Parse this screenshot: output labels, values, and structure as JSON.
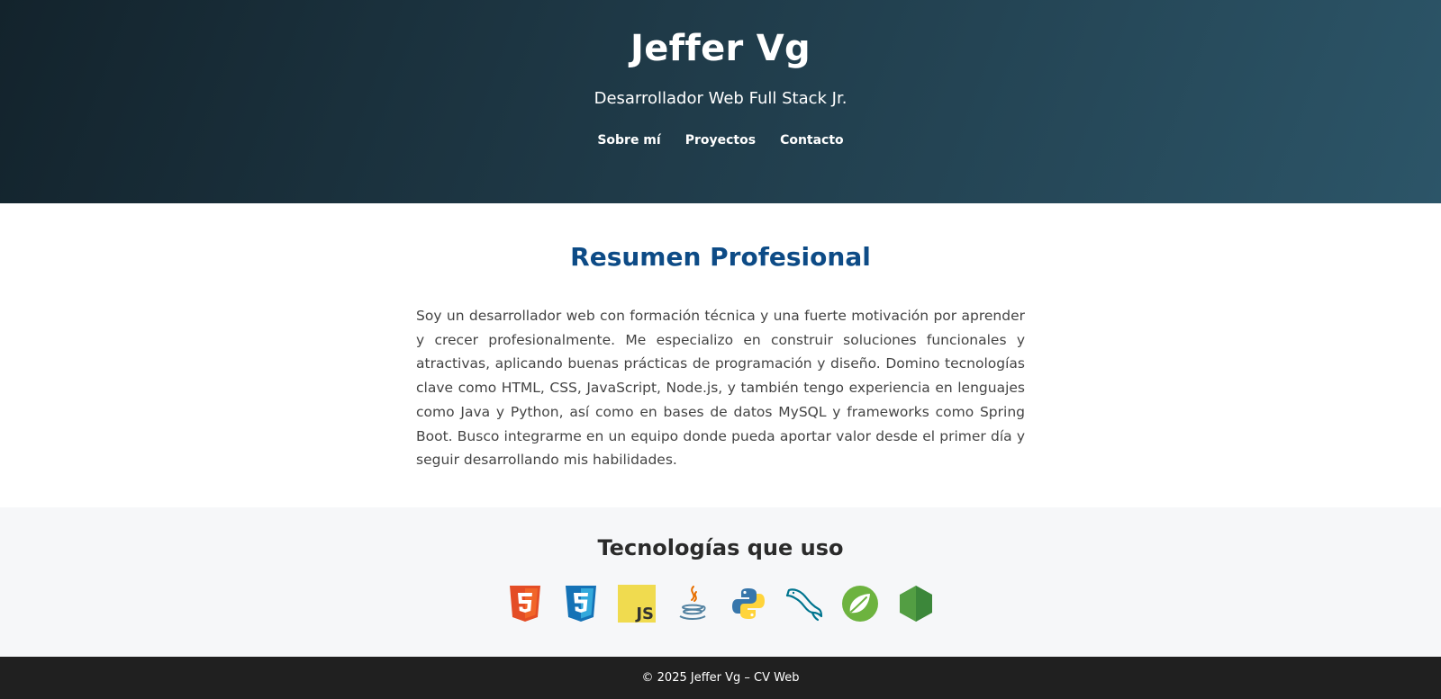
{
  "header": {
    "name": "Jeffer Vg",
    "subtitle": "Desarrollador Web Full Stack Jr.",
    "nav": [
      "Sobre mí",
      "Proyectos",
      "Contacto"
    ],
    "gradient_colors": [
      "#13232c",
      "#2c5568"
    ]
  },
  "summary": {
    "title": "Resumen Profesional",
    "body": "Soy un desarrollador web con formación técnica y una fuerte motivación por aprender y crecer profesionalmente. Me especializo en construir soluciones funcionales y atractivas, aplicando buenas prácticas de programación y diseño. Domino tecnologías clave como HTML, CSS, JavaScript, Node.js, y también tengo experiencia en lenguajes como Java y Python, así como en bases de datos MySQL y frameworks como Spring Boot. Busco integrarme en un equipo donde pueda aportar valor desde el primer día y seguir desarrollando mis habilidades.",
    "title_color": "#0d4b86"
  },
  "technologies": {
    "title": "Tecnologías que uso",
    "icons": [
      "html5-icon",
      "css3-icon",
      "javascript-icon",
      "java-icon",
      "python-icon",
      "mysql-icon",
      "spring-icon",
      "nodejs-icon"
    ]
  },
  "footer": {
    "text": "© 2025 Jeffer Vg – CV Web"
  }
}
